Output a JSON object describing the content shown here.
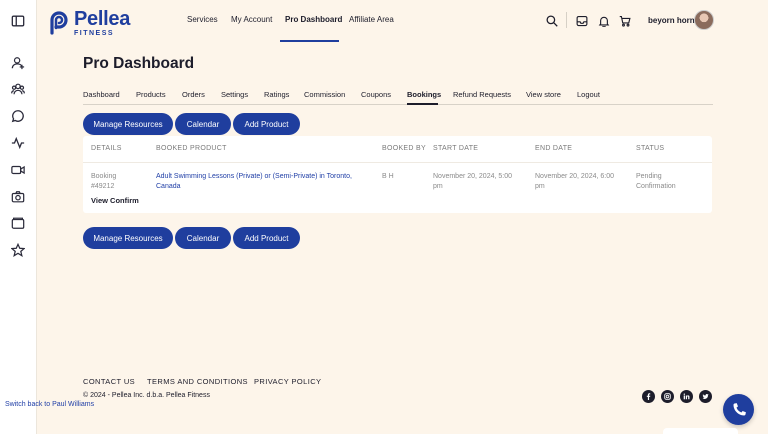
{
  "header": {
    "logo_name": "Pellea",
    "logo_sub": "FITNESS",
    "nav": [
      "Services",
      "My Account",
      "Pro Dashboard",
      "Affiliate Area"
    ],
    "active_nav": "Pro Dashboard",
    "username": "beyorn horn",
    "icons": [
      "search-icon",
      "inbox-icon",
      "bell-icon",
      "cart-icon"
    ]
  },
  "sidebar": {
    "icons": [
      "sidebar-toggle-icon",
      "user-plus-icon",
      "users-icon",
      "chat-icon",
      "activity-icon",
      "video-icon",
      "camera-icon",
      "wallet-icon",
      "star-icon"
    ]
  },
  "page": {
    "title": "Pro Dashboard",
    "tabs": [
      "Dashboard",
      "Products",
      "Orders",
      "Settings",
      "Ratings",
      "Commission",
      "Coupons",
      "Bookings",
      "Refund Requests",
      "View store",
      "Logout"
    ],
    "selected_tab": "Bookings",
    "buttons": [
      "Manage Resources",
      "Calendar",
      "Add Product"
    ]
  },
  "table": {
    "columns": [
      "DETAILS",
      "BOOKED PRODUCT",
      "BOOKED BY",
      "START DATE",
      "END DATE",
      "STATUS"
    ],
    "rows": [
      {
        "details_line1": "Booking",
        "details_line2": "#49212",
        "product_line1": "Adult Swimming Lessons (Private) or (Semi-Private) in Toronto,",
        "product_line2": "Canada",
        "booked_by": "B H",
        "start_line1": "November 20, 2024, 5:00",
        "start_line2": "pm",
        "end_line1": "November 20, 2024, 6:00",
        "end_line2": "pm",
        "status_line1": "Pending",
        "status_line2": "Confirmation",
        "action": "View Confirm"
      }
    ]
  },
  "footer": {
    "links": [
      "CONTACT US",
      "TERMS AND CONDITIONS",
      "PRIVACY POLICY"
    ],
    "copyright": "© 2024 - Pellea Inc. d.b.a. Pellea Fitness",
    "social_icons": [
      "facebook-icon",
      "instagram-icon",
      "linkedin-icon",
      "twitter-icon"
    ],
    "switch_back": "Switch back to Paul Williams"
  },
  "colors": {
    "brand": "#1f3e9e",
    "background": "#fdf5ea",
    "link": "#1f3ea6"
  }
}
